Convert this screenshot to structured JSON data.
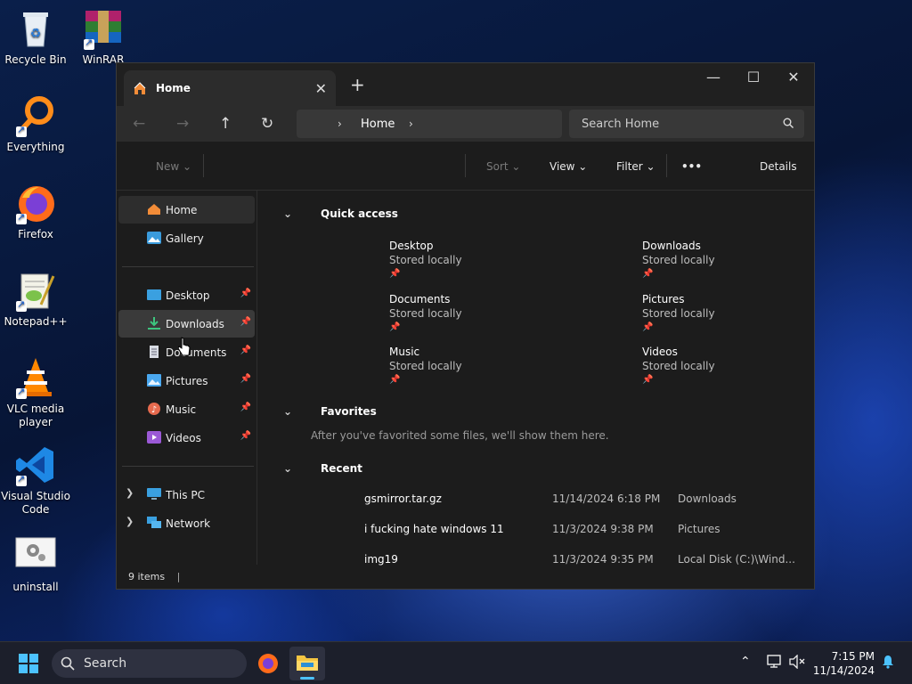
{
  "desktop_icons": [
    {
      "label": "Recycle Bin"
    },
    {
      "label": "WinRAR"
    },
    {
      "label": "Everything"
    },
    {
      "label": "Firefox"
    },
    {
      "label": "Notepad++"
    },
    {
      "label": "VLC media\nplayer"
    },
    {
      "label": "Visual Studio\nCode"
    },
    {
      "label": "uninstall"
    }
  ],
  "window": {
    "tab_title": "Home",
    "tab_close": "✕",
    "new_tab": "+",
    "minimize": "—",
    "maximize": "☐",
    "close": "✕"
  },
  "nav": {
    "back": "←",
    "forward": "→",
    "up": "↑",
    "refresh": "↻",
    "breadcrumb": "Home",
    "search_placeholder": "Search Home"
  },
  "toolbar": {
    "new_label": "New",
    "sort_label": "Sort",
    "view_label": "View",
    "filter_label": "Filter",
    "more_label": "•••",
    "details_label": "Details"
  },
  "sidebar": {
    "items": [
      {
        "label": "Home"
      },
      {
        "label": "Gallery"
      },
      {
        "label": "Desktop"
      },
      {
        "label": "Downloads"
      },
      {
        "label": "Documents"
      },
      {
        "label": "Pictures"
      },
      {
        "label": "Music"
      },
      {
        "label": "Videos"
      },
      {
        "label": "This PC"
      },
      {
        "label": "Network"
      }
    ]
  },
  "sections": {
    "quick_access": "Quick access",
    "favorites": "Favorites",
    "favorites_empty": "After you've favorited some files, we'll show them here.",
    "recent": "Recent"
  },
  "quick_access": [
    {
      "name": "Desktop",
      "sub": "Stored locally"
    },
    {
      "name": "Downloads",
      "sub": "Stored locally"
    },
    {
      "name": "Documents",
      "sub": "Stored locally"
    },
    {
      "name": "Pictures",
      "sub": "Stored locally"
    },
    {
      "name": "Music",
      "sub": "Stored locally"
    },
    {
      "name": "Videos",
      "sub": "Stored locally"
    }
  ],
  "recent": [
    {
      "name": "gsmirror.tar.gz",
      "date": "11/14/2024 6:18 PM",
      "location": "Downloads"
    },
    {
      "name": "i fucking hate windows 11",
      "date": "11/3/2024 9:38 PM",
      "location": "Pictures"
    },
    {
      "name": "img19",
      "date": "11/3/2024 9:35 PM",
      "location": "Local Disk (C:)\\Wind..."
    }
  ],
  "status": {
    "items": "9 items"
  },
  "taskbar": {
    "search_label": "Search",
    "time": "7:15 PM",
    "date": "11/14/2024"
  },
  "colors": {
    "accent": "#0078d4",
    "folder": "#f4c542"
  }
}
